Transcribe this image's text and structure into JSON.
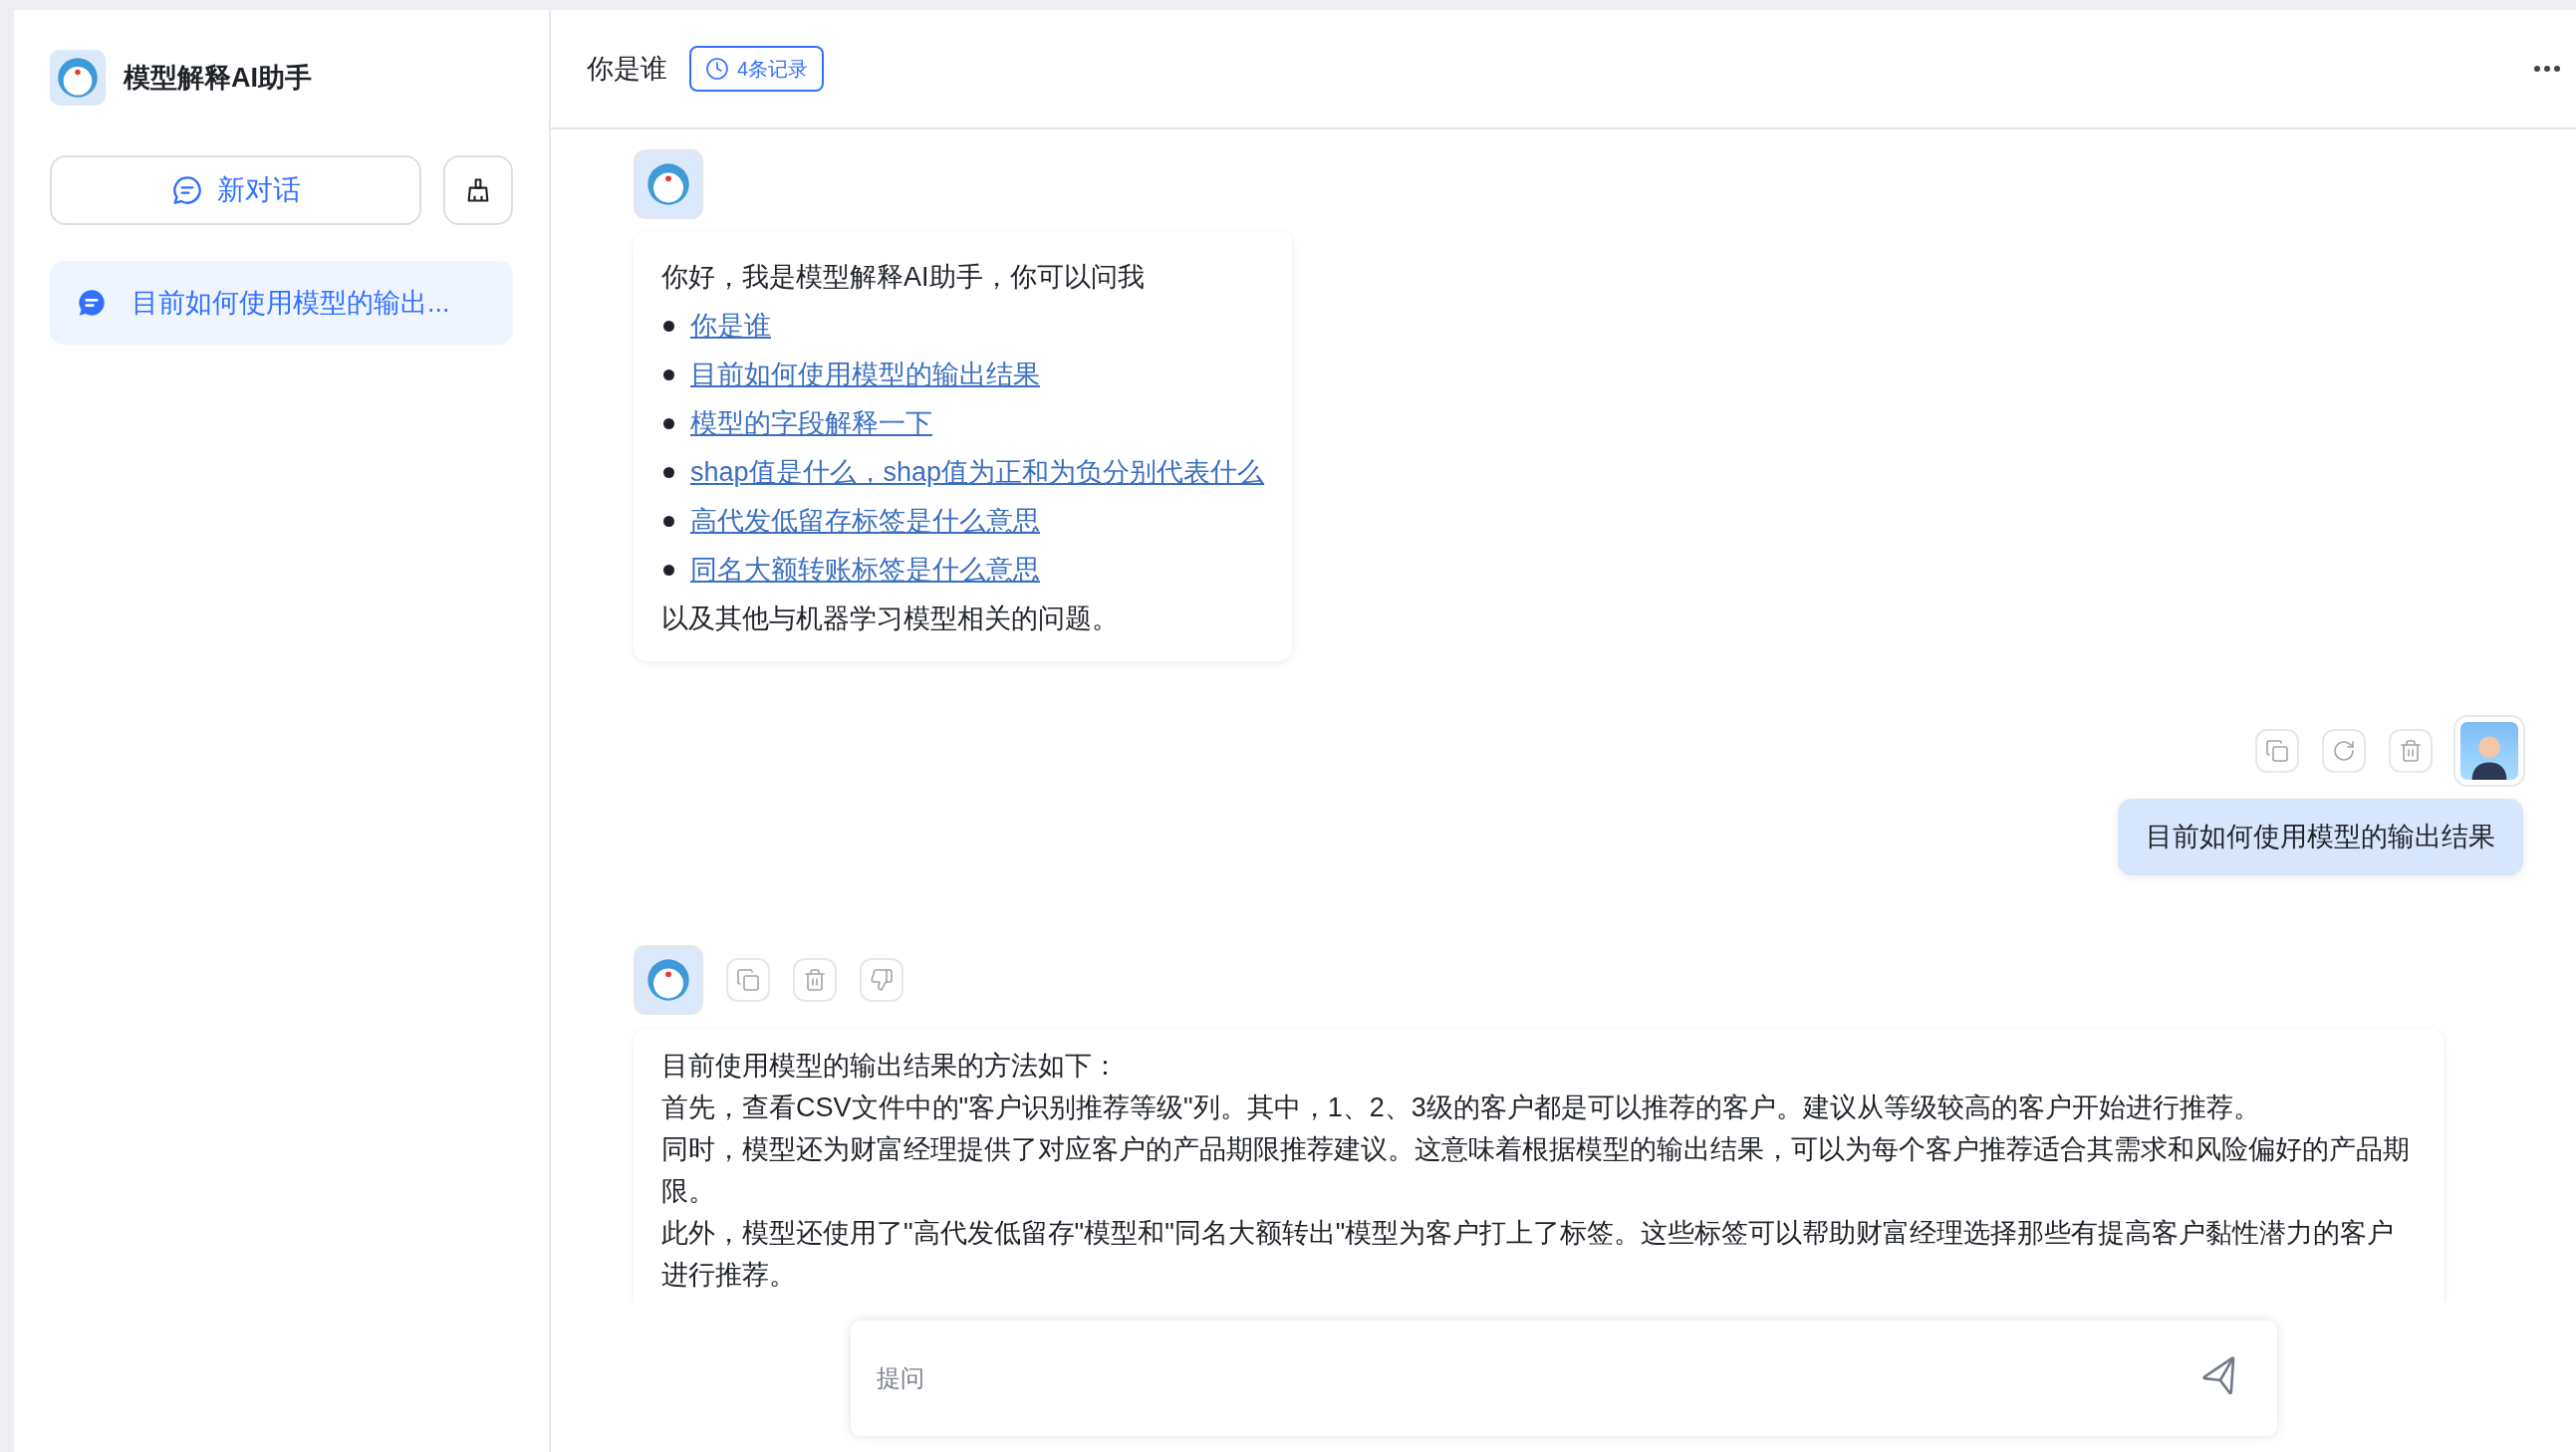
{
  "sidebar": {
    "title": "模型解释AI助手",
    "new_chat_button": "新对话",
    "conversations": [
      {
        "title": "目前如何使用模型的输出...",
        "selected": true
      }
    ]
  },
  "header": {
    "title": "你是谁",
    "history_badge": "4条记录"
  },
  "messages": [
    {
      "kind": "bot-suggestions",
      "intro": "你好，我是模型解释AI助手，你可以问我",
      "suggestions": [
        "你是谁",
        "目前如何使用模型的输出结果",
        "模型的字段解释一下",
        "shap值是什么，shap值为正和为负分别代表什么",
        "高代发低留存标签是什么意思",
        "同名大额转账标签是什么意思"
      ],
      "outro": "以及其他与机器学习模型相关的问题。"
    },
    {
      "kind": "user",
      "text": "目前如何使用模型的输出结果",
      "actions": [
        {
          "kind": "copy"
        },
        {
          "kind": "refresh"
        },
        {
          "kind": "delete"
        }
      ]
    },
    {
      "kind": "bot",
      "paragraphs": [
        "目前使用模型的输出结果的方法如下：",
        "首先，查看CSV文件中的\"客户识别推荐等级\"列。其中，1、2、3级的客户都是可以推荐的客户。建议从等级较高的客户开始进行推荐。",
        "同时，模型还为财富经理提供了对应客户的产品期限推荐建议。这意味着根据模型的输出结果，可以为每个客户推荐适合其需求和风险偏好的产品期限。",
        "此外，模型还使用了\"高代发低留存\"模型和\"同名大额转出\"模型为客户打上了标签。这些标签可以帮助财富经理选择那些有提高客户黏性潜力的客户进行推荐。"
      ],
      "actions": [
        {
          "kind": "copy"
        },
        {
          "kind": "delete"
        },
        {
          "kind": "dislike"
        }
      ]
    }
  ],
  "input": {
    "placeholder": "提问"
  }
}
